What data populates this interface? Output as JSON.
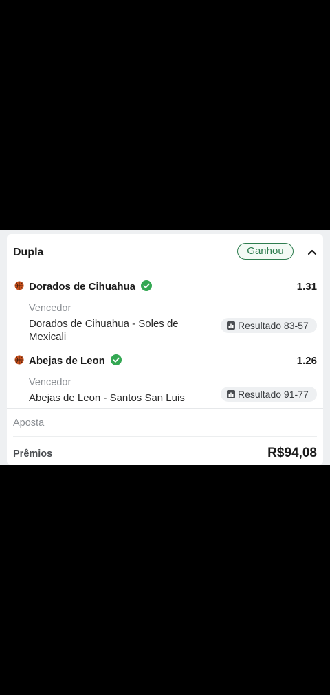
{
  "bet": {
    "type_label": "Dupla",
    "status": "Ganhou",
    "legs": [
      {
        "team": "Dorados de Cihuahua",
        "odds": "1.31",
        "market": "Vencedor",
        "event": "Dorados de Cihuahua - Soles de Mexicali",
        "result": "Resultado 83-57",
        "sport_icon": "basketball-icon",
        "won_icon": "check-circle-icon"
      },
      {
        "team": "Abejas de Leon",
        "odds": "1.26",
        "market": "Vencedor",
        "event": "Abejas de Leon - Santos San Luis",
        "result": "Resultado 91-77",
        "sport_icon": "basketball-icon",
        "won_icon": "check-circle-icon"
      }
    ],
    "stake_label": "Aposta",
    "prize_label": "Prêmios",
    "prize_value": "R$94,08"
  },
  "colors": {
    "won_green": "#2e7d4f",
    "check_green": "#34a853",
    "ball_orange": "#c9501c"
  }
}
